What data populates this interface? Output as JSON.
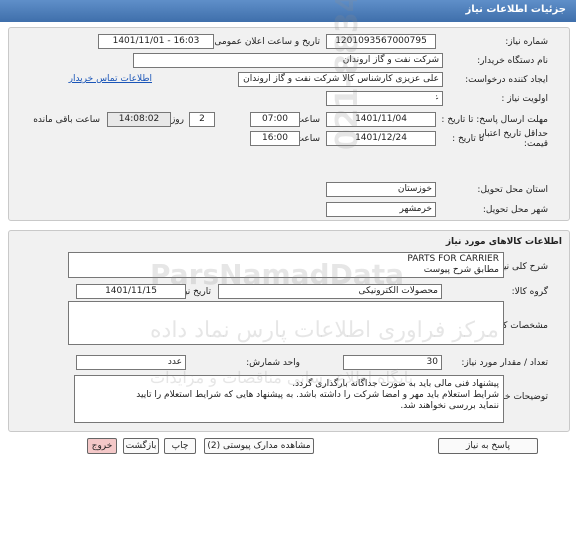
{
  "title": "جزئیات اطلاعات نیاز",
  "labels": {
    "need_number": "شماره نیاز:",
    "announce_datetime": "تاریخ و ساعت اعلان عمومی:",
    "buyer_org": "نام دستگاه خریدار:",
    "creator": "ایجاد کننده درخواست:",
    "priority": "اولویت نیاز :",
    "reply_deadline": "مهلت ارسال پاسخ: تا تاریخ :",
    "min_validity_1": "حداقل تاریخ اعتبار",
    "min_validity_2": "قیمت:",
    "to_date": "تا تاریخ :",
    "time": "ساعت",
    "day_and": "روز و",
    "hours_remaining": "ساعت باقی مانده",
    "delivery_province": "استان محل تحویل:",
    "delivery_city": "شهر محل تحویل:",
    "goods_section": "اطلاعات کالاهای مورد نیاز",
    "general_description": "شرح کلی نیاز:",
    "goods_group": "گروه کالا:",
    "goods_need_date": "تاریخ نیاز به کالا:",
    "goods_specs": "مشخصات کالای مورد نیاز:",
    "quantity": "تعداد / مقدار مورد نیاز:",
    "unit": "واحد شمارش:",
    "buyer_notes": "توضیحات خریدار:"
  },
  "values": {
    "need_number": "1201093567000795",
    "announce_datetime": "1401/11/01 - 16:03",
    "buyer_org": "شرکت نفت و گاز اروندان",
    "creator": "علی عزیزی کارشناس کالا شرکت نفت و گاز اروندان",
    "buyer_contact_link": "اطلاعات تماس خریدار",
    "priority": "عادی",
    "reply_date": "1401/11/04",
    "reply_time": "07:00",
    "remaining_days": "2",
    "remaining_time": "14:08:02",
    "validity_date": "1401/12/24",
    "validity_time": "16:00",
    "province": "خوزستان",
    "city": "خرمشهر",
    "description_line1": "PARTS FOR CARRIER",
    "description_line2": "مطابق شرح پیوست",
    "goods_group": "محصولات الکترونیکی",
    "goods_need_date": "1401/11/15",
    "quantity": "30",
    "unit": "عدد",
    "notes_line1": "پیشنهاد فنی مالی باید به صورت جداگانه بارگذاری گردد.",
    "notes_line2": "شرایط استعلام باید مهر و امضا شرکت را داشته باشد. به پیشنهاد هایی که شرایط استعلام را تایید",
    "notes_line3": "ننماید بررسی نخواهند شد."
  },
  "buttons": {
    "reply": "پاسخ به نیاز",
    "view_docs": "مشاهده مدارک پیوستی (2)",
    "print": "چاپ",
    "back": "بازگشت",
    "exit": "خروج"
  },
  "watermark": {
    "line1": "مرکز فراوری اطلاعات پارس نماد داده",
    "line2": "پایگاه اطلاع رسانی مناقصات و مزایدات",
    "brand": "ParsNamadData",
    "phone": "021-88349670"
  },
  "colors": {
    "title_bar": "#4a7ab8",
    "panel": "#f1f1f1",
    "link": "#1a55b8",
    "exit_button": "#f4c8c8"
  }
}
